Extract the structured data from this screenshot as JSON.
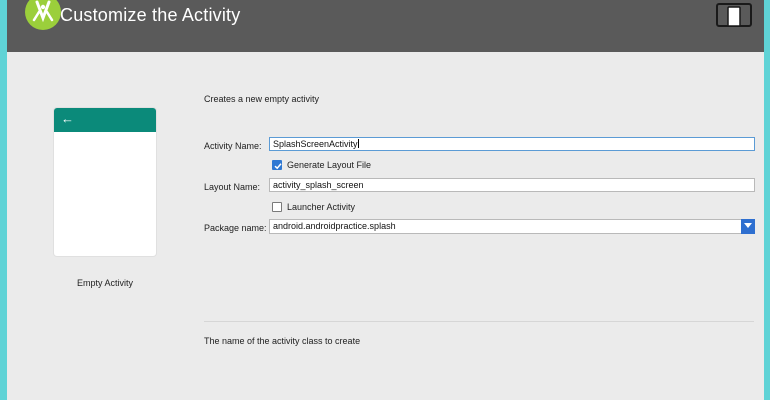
{
  "window": {
    "title": "Customize the Activity"
  },
  "template": {
    "preview_label": "Empty Activity",
    "description": "Creates a new empty activity"
  },
  "form": {
    "activity_name": {
      "label": "Activity Name:",
      "value": "SplashScreenActivity"
    },
    "generate_layout": {
      "label": "Generate Layout File",
      "checked": true
    },
    "layout_name": {
      "label": "Layout Name:",
      "value": "activity_splash_screen"
    },
    "launcher_activity": {
      "label": "Launcher Activity",
      "checked": false
    },
    "package_name": {
      "label": "Package name:",
      "value": "android.androidpractice.splash"
    }
  },
  "help_text": "The name of the activity class to create",
  "colors": {
    "titlebar": "#5a5a5a",
    "accent_teal": "#0b8a7a",
    "logo_green": "#9bcf3b",
    "checkbox_blue": "#2e78d3",
    "frame": "#5fd3d6"
  },
  "icons": {
    "logo": "android-studio-logo-icon",
    "device": "device-preview-icon",
    "back": "back-arrow-icon"
  }
}
